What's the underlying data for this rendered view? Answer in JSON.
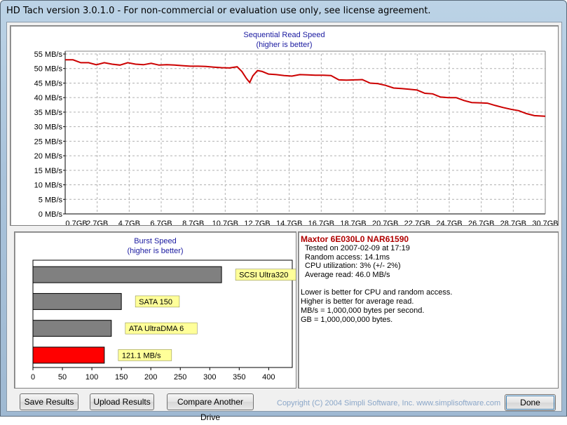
{
  "window": {
    "title": "HD Tach version 3.0.1.0  - For non-commercial or evaluation use only, see license agreement."
  },
  "sequential": {
    "title": "Sequential Read Speed",
    "subtitle": "(higher is better)"
  },
  "burst": {
    "title": "Burst Speed",
    "subtitle": "(higher is better)"
  },
  "chart_data": [
    {
      "type": "line",
      "title": "Sequential Read Speed",
      "subtitle": "(higher is better)",
      "xlabel": "",
      "ylabel": "",
      "ylim": [
        0,
        55
      ],
      "y_tick_labels": [
        "0 MB/s",
        "5 MB/s",
        "10 MB/s",
        "15 MB/s",
        "20 MB/s",
        "25 MB/s",
        "30 MB/s",
        "35 MB/s",
        "40 MB/s",
        "45 MB/s",
        "50 MB/s",
        "55 MB/s"
      ],
      "x_tick_labels": [
        "0,7GB",
        "2,7GB",
        "4,7GB",
        "6,7GB",
        "8,7GB",
        "10,7GB",
        "12,7GB",
        "14,7GB",
        "16,7GB",
        "18,7GB",
        "20,7GB",
        "22,7GB",
        "24,7GB",
        "26,7GB",
        "28,7GB",
        "30,7GB"
      ],
      "xlim": [
        0,
        30.7
      ],
      "grid": true,
      "line_color": "#cc0000",
      "series": [
        {
          "x": [
            0,
            0.5,
            1,
            1.5,
            2,
            2.5,
            3,
            3.5,
            4,
            4.5,
            5,
            5.5,
            6,
            6.5,
            7,
            7.5,
            8,
            8.5,
            9,
            9.5,
            10,
            10.5,
            11,
            11.3,
            11.6,
            11.8,
            12,
            12.3,
            12.6,
            13,
            13.5,
            14,
            14.5,
            15,
            15.5,
            16,
            16.5,
            17,
            17.5,
            18,
            18.5,
            19,
            19.5,
            20,
            20.5,
            21,
            21.5,
            22,
            22.5,
            23,
            23.5,
            24,
            24.5,
            25,
            25.5,
            26,
            26.5,
            27,
            27.5,
            28,
            28.5,
            29,
            29.5,
            30,
            30.7
          ],
          "y": [
            53,
            53,
            52,
            52,
            51.3,
            52,
            51.5,
            51.2,
            52,
            51.5,
            51.3,
            51.8,
            51.2,
            51.3,
            51.2,
            51,
            50.8,
            50.8,
            50.7,
            50.5,
            50.3,
            50.2,
            50.6,
            49,
            46.5,
            45.2,
            47.5,
            49.3,
            49,
            48.1,
            47.9,
            47.6,
            47.4,
            47.9,
            47.8,
            47.7,
            47.7,
            47.6,
            46.1,
            46,
            46.1,
            46.2,
            45,
            44.8,
            44.2,
            43.3,
            43.1,
            42.9,
            42.6,
            41.5,
            41.3,
            40.2,
            40,
            40,
            39,
            38.3,
            38.2,
            38.1,
            37.3,
            36.6,
            36,
            35.5,
            34.5,
            33.8,
            33.6
          ]
        }
      ]
    },
    {
      "type": "bar",
      "orientation": "horizontal",
      "title": "Burst Speed",
      "subtitle": "(higher is better)",
      "xlim": [
        0,
        440
      ],
      "x_tick_labels": [
        "0",
        "50",
        "100",
        "150",
        "200",
        "250",
        "300",
        "350",
        "400"
      ],
      "categories": [
        "SCSI Ultra320",
        "SATA 150",
        "ATA UltraDMA 6",
        "121.1 MB/s"
      ],
      "values": [
        320,
        150,
        133,
        121.1
      ],
      "colors": [
        "#808080",
        "#808080",
        "#808080",
        "#ff0000"
      ],
      "label_bg": "#ffff99"
    }
  ],
  "drive": {
    "name": "Maxtor 6E030L0 NAR61590",
    "tested_on": "Tested on 2007-02-09 at 17:19",
    "random_access": "Random access: 14.1ms",
    "cpu_util": "CPU utilization: 3% (+/- 2%)",
    "avg_read": "Average read: 46.0 MB/s"
  },
  "notes": {
    "line1": "Lower is better for CPU and random access.",
    "line2": "Higher is better for average read.",
    "line3": "MB/s = 1,000,000 bytes per second.",
    "line4": "GB = 1,000,000,000 bytes."
  },
  "buttons": {
    "save": "Save Results",
    "upload": "Upload Results",
    "compare": "Compare Another Drive",
    "done": "Done"
  },
  "copyright": "Copyright (C) 2004 Simpli Software, Inc. www.simplisoftware.com"
}
